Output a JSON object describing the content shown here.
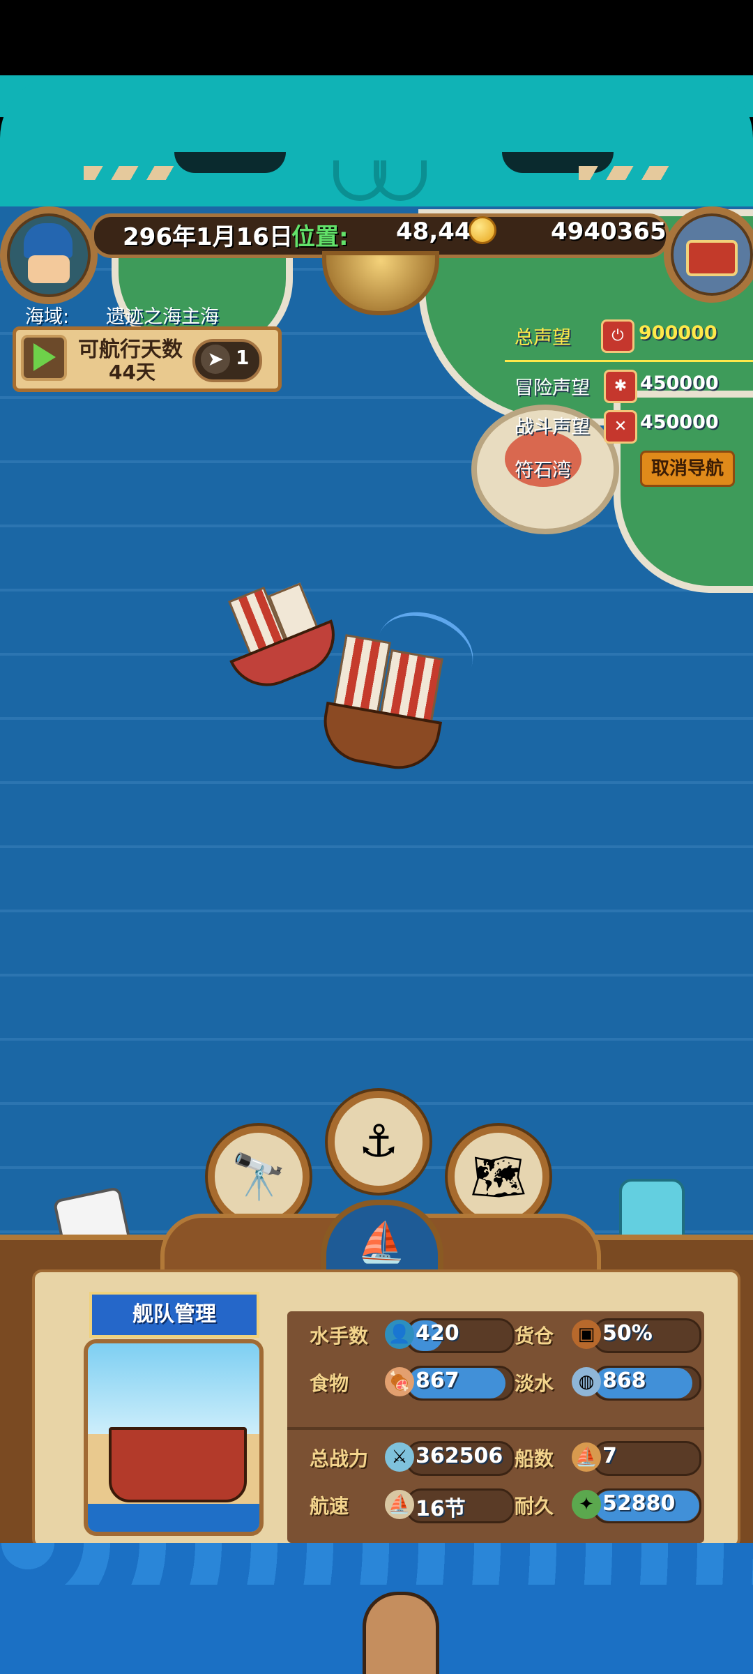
{
  "header": {
    "date": "296年1月16日",
    "position_label": "位置:",
    "position_value": "48,44",
    "gold": "4940365"
  },
  "sea_area": {
    "label": "海域:",
    "value": "遗迹之海主海"
  },
  "sail_panel": {
    "title": "可航行天数",
    "days": "44天",
    "nav_count": "1"
  },
  "reputation": {
    "total_label": "总声望",
    "total_value": "900000",
    "adventure_label": "冒险声望",
    "adventure_value": "450000",
    "battle_label": "战斗声望",
    "battle_value": "450000",
    "destination_label": "符石湾",
    "cancel_nav": "取消导航"
  },
  "fleet": {
    "title": "舰队管理",
    "stats": [
      {
        "label": "水手数",
        "value": "420",
        "icon": "sailor-icon",
        "fill": 0.33
      },
      {
        "label": "货仓",
        "value": "50%",
        "icon": "cargo-icon",
        "fill": 0.0
      },
      {
        "label": "食物",
        "value": "867",
        "icon": "food-icon",
        "fill": 0.93
      },
      {
        "label": "淡水",
        "value": "868",
        "icon": "water-icon",
        "fill": 0.93
      },
      {
        "label": "总战力",
        "value": "362506",
        "icon": "power-icon",
        "fill": 0.0
      },
      {
        "label": "船数",
        "value": "7",
        "icon": "ship-count-icon",
        "fill": 0.0
      },
      {
        "label": "航速",
        "value": "16节",
        "icon": "speed-icon",
        "fill": 0.0
      },
      {
        "label": "耐久",
        "value": "52880",
        "icon": "durability-icon",
        "fill": 1.0
      }
    ]
  },
  "colors": {
    "sea": "#1b67a5",
    "header_teal": "#10b3b6",
    "wood": "#a5743e",
    "bar_blue": "#4190d8",
    "total_reputation": "#ffe84a"
  }
}
